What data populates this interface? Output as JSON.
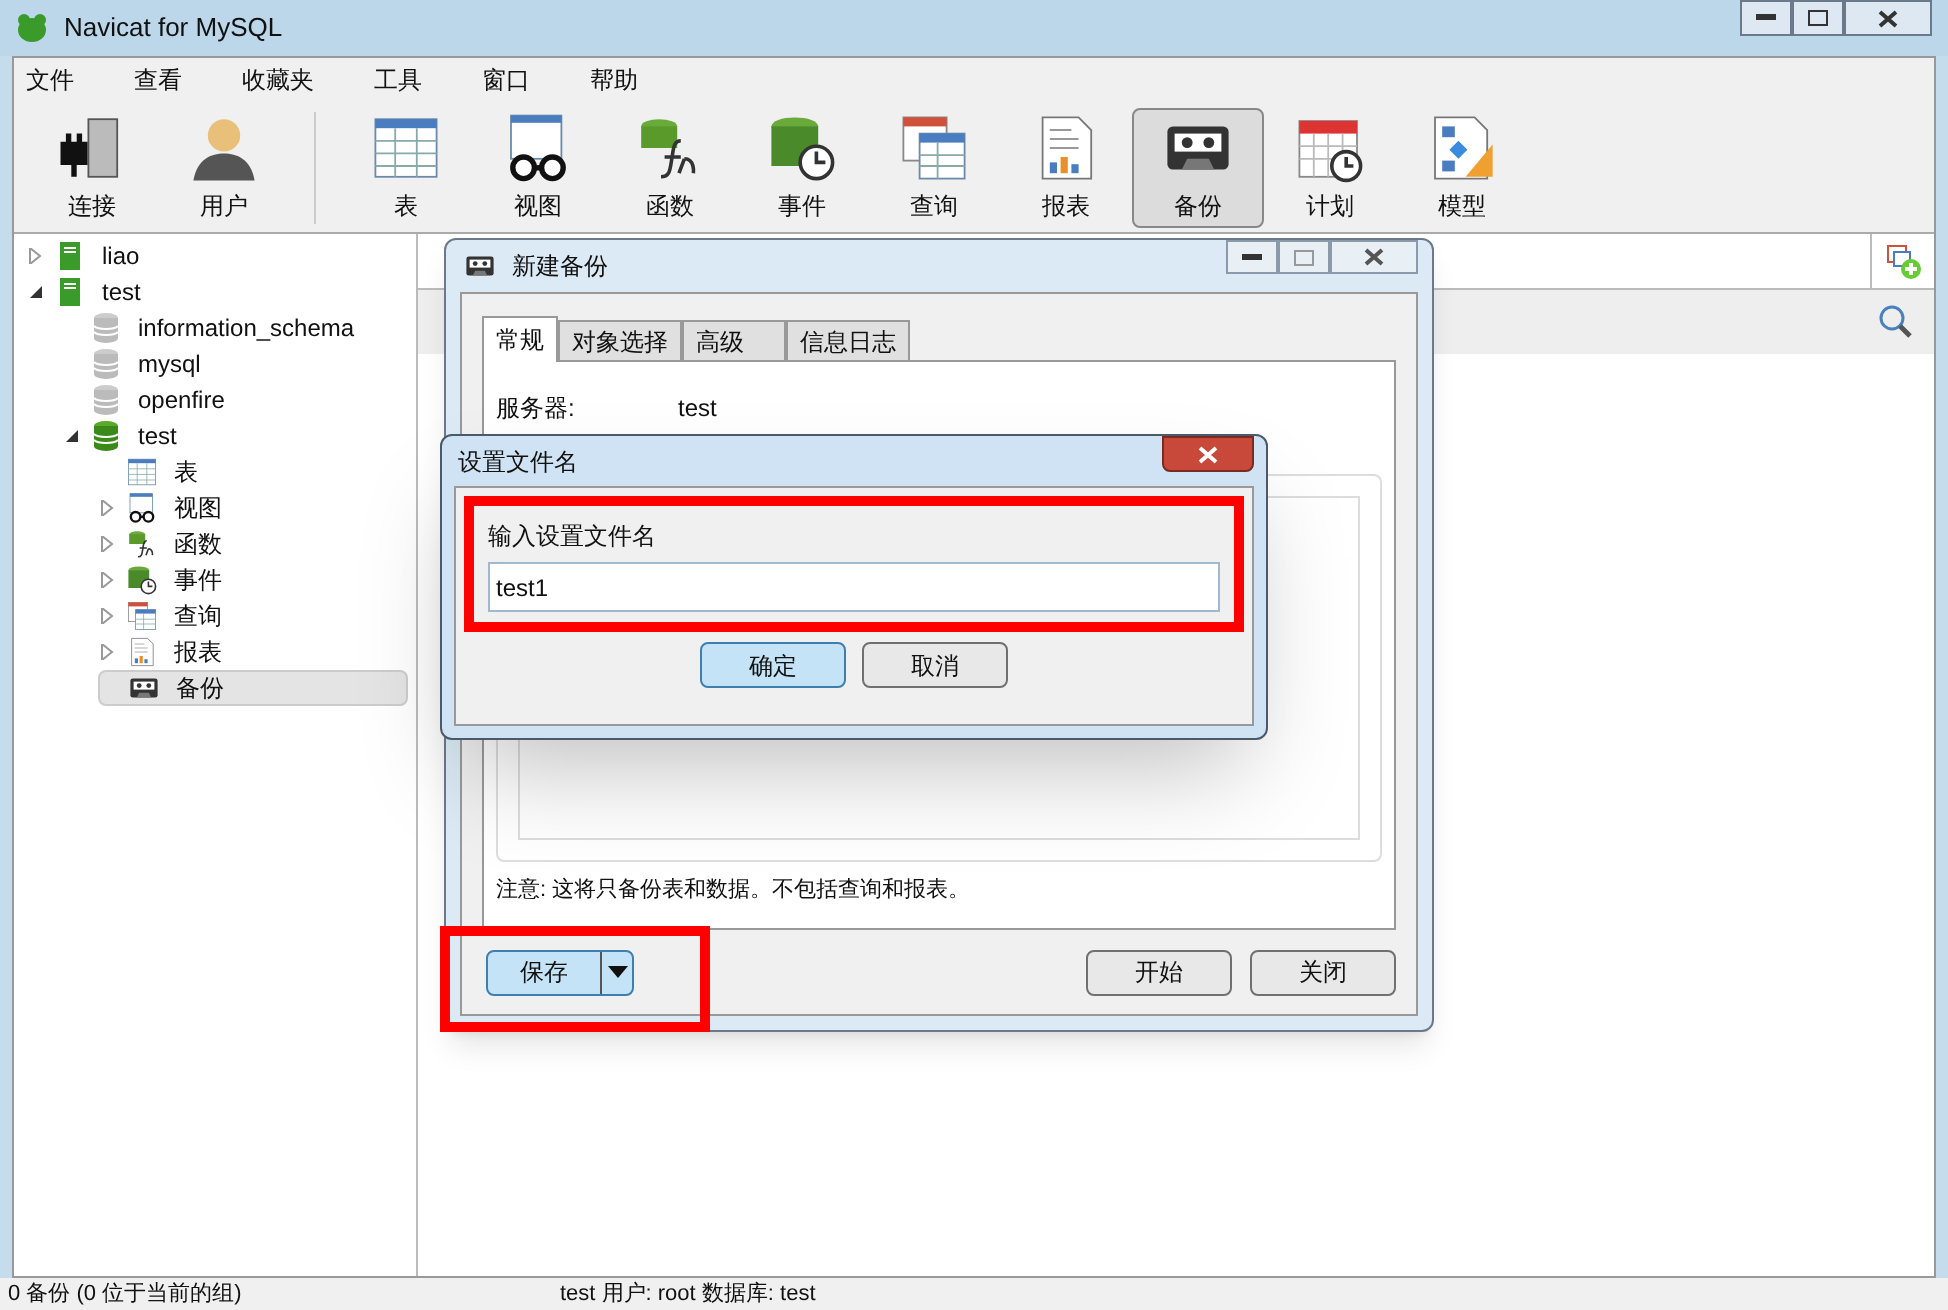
{
  "window": {
    "title": "Navicat for MySQL"
  },
  "menu": [
    "文件",
    "查看",
    "收藏夹",
    "工具",
    "窗口",
    "帮助"
  ],
  "toolbar": [
    {
      "label": "连接",
      "kind": "connect",
      "selected": false
    },
    {
      "label": "用户",
      "kind": "user",
      "selected": false
    },
    {
      "label": "表",
      "kind": "table",
      "selected": false
    },
    {
      "label": "视图",
      "kind": "view",
      "selected": false
    },
    {
      "label": "函数",
      "kind": "function",
      "selected": false
    },
    {
      "label": "事件",
      "kind": "event",
      "selected": false
    },
    {
      "label": "查询",
      "kind": "query",
      "selected": false
    },
    {
      "label": "报表",
      "kind": "report",
      "selected": false
    },
    {
      "label": "备份",
      "kind": "backup",
      "selected": true
    },
    {
      "label": "计划",
      "kind": "schedule",
      "selected": false
    },
    {
      "label": "模型",
      "kind": "model",
      "selected": false
    }
  ],
  "tree": [
    {
      "label": "liao",
      "kind": "server",
      "expanded": false,
      "selected": false
    },
    {
      "label": "test",
      "kind": "server",
      "expanded": true,
      "selected": false,
      "children": [
        {
          "label": "information_schema",
          "kind": "db_closed",
          "selected": false
        },
        {
          "label": "mysql",
          "kind": "db_closed",
          "selected": false
        },
        {
          "label": "openfire",
          "kind": "db_closed",
          "selected": false
        },
        {
          "label": "test",
          "kind": "db_open",
          "expanded": true,
          "selected": false,
          "children": [
            {
              "label": "表",
              "kind": "table",
              "selected": false
            },
            {
              "label": "视图",
              "kind": "view",
              "expanded": false,
              "selected": false
            },
            {
              "label": "函数",
              "kind": "function",
              "expanded": false,
              "selected": false
            },
            {
              "label": "事件",
              "kind": "event",
              "expanded": false,
              "selected": false
            },
            {
              "label": "查询",
              "kind": "query",
              "expanded": false,
              "selected": false
            },
            {
              "label": "报表",
              "kind": "report",
              "expanded": false,
              "selected": false
            },
            {
              "label": "备份",
              "kind": "backup",
              "selected": true
            }
          ]
        }
      ]
    }
  ],
  "backup_dialog": {
    "title": "新建备份",
    "tabs": [
      {
        "label": "常规",
        "selected": true
      },
      {
        "label": "对象选择",
        "selected": false
      },
      {
        "label": "高级",
        "selected": false
      },
      {
        "label": "信息日志",
        "selected": false
      }
    ],
    "server_label": "服务器:",
    "server_value": "test",
    "note": "注意: 这将只备份表和数据。不包括查询和报表。",
    "save_button": "保存",
    "buttons": [
      "开始",
      "关闭"
    ]
  },
  "filename_dialog": {
    "title": "设置文件名",
    "prompt": "输入设置文件名",
    "value": "test1",
    "buttons": [
      {
        "label": "确定",
        "selected": true
      },
      {
        "label": "取消",
        "selected": false
      }
    ]
  },
  "status_bar": {
    "left": "0 备份 (0 位于当前的组)",
    "right": "test  用户: root  数据库: test"
  }
}
